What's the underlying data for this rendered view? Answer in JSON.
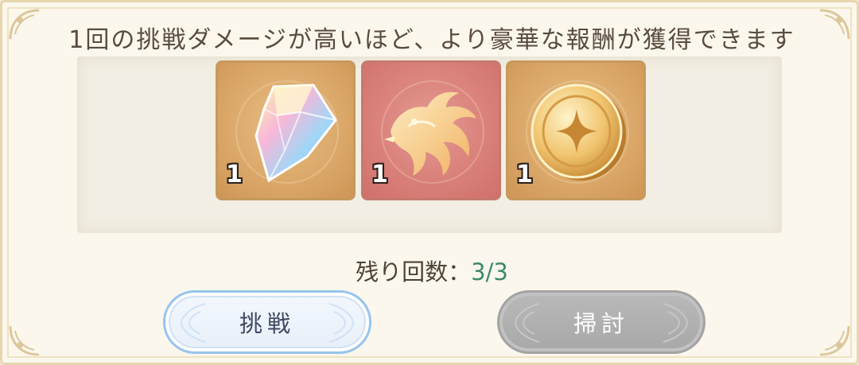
{
  "header": {
    "description": "1回の挑戦ダメージが高いほど、より豪華な報酬が獲得できます"
  },
  "rewards": [
    {
      "icon": "prism-crystal-icon",
      "count": "1"
    },
    {
      "icon": "golden-dragon-icon",
      "count": "1"
    },
    {
      "icon": "gold-coin-icon",
      "count": "1"
    }
  ],
  "attempts": {
    "label": "残り回数：",
    "value": "3/3"
  },
  "buttons": {
    "challenge_label": "挑戦",
    "sweep_label": "掃討"
  },
  "colors": {
    "attempts_value": "#3d8a6a",
    "challenge_border": "#96c4ee",
    "sweep_disabled": "#acacac",
    "reward_frame_gold": "#d9a566",
    "reward_frame_red": "#d97f79"
  }
}
